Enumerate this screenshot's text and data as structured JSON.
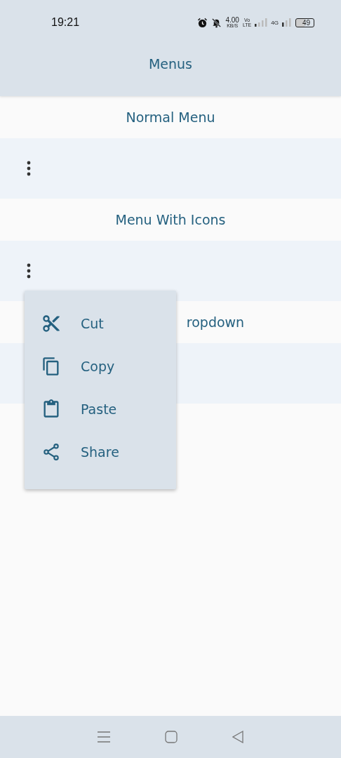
{
  "status_bar": {
    "time": "19:21",
    "speed": "4.00",
    "speed_unit": "KB/S",
    "volte_top": "Vo",
    "volte_bottom": "LTE",
    "network": "4G",
    "battery": "49"
  },
  "app_bar": {
    "title": "Menus"
  },
  "sections": [
    {
      "title": "Normal Menu"
    },
    {
      "title": "Menu With Icons"
    },
    {
      "title": "ropdown"
    }
  ],
  "menu": {
    "items": [
      {
        "label": "Cut",
        "kind": "cut"
      },
      {
        "label": "Copy",
        "kind": "copy"
      },
      {
        "label": "Paste",
        "kind": "paste"
      },
      {
        "label": "Share",
        "kind": "share"
      }
    ]
  }
}
